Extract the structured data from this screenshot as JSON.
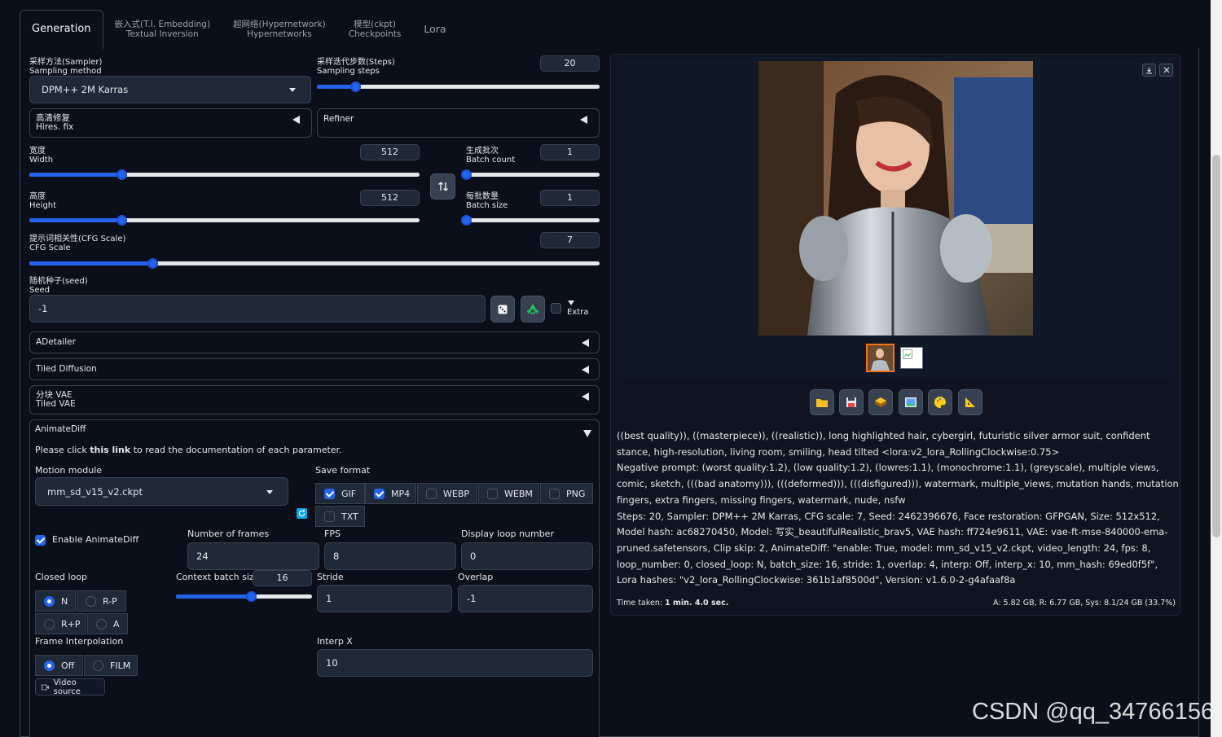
{
  "tabs": [
    {
      "label": "Generation"
    },
    {
      "label": "嵌入式(T.I. Embedding)",
      "sub": "Textual Inversion"
    },
    {
      "label": "超网络(Hypernetwork)",
      "sub": "Hypernetworks"
    },
    {
      "label": "模型(ckpt)",
      "sub": "Checkpoints"
    },
    {
      "label": "Lora"
    }
  ],
  "sampler": {
    "label_cn": "采样方法(Sampler)",
    "label_en": "Sampling method",
    "value": "DPM++ 2M Karras"
  },
  "steps": {
    "label_cn": "采样迭代步数(Steps)",
    "label_en": "Sampling steps",
    "value": "20",
    "fraction": 0.135
  },
  "hires": {
    "label_cn": "高清修复",
    "label_en": "Hires. fix"
  },
  "refiner": {
    "label": "Refiner"
  },
  "width": {
    "label_cn": "宽度",
    "label_en": "Width",
    "value": "512",
    "fraction": 0.235
  },
  "height": {
    "label_cn": "高度",
    "label_en": "Height",
    "value": "512",
    "fraction": 0.235
  },
  "batch_count": {
    "label_cn": "生成批次",
    "label_en": "Batch count",
    "value": "1",
    "fraction": 0.0
  },
  "batch_size": {
    "label_cn": "每批数量",
    "label_en": "Batch size",
    "value": "1",
    "fraction": 0.0
  },
  "swap_icon": "swap-arrows-icon",
  "cfg": {
    "label_cn": "提示词相关性(CFG Scale)",
    "label_en": "CFG Scale",
    "value": "7",
    "fraction": 0.215
  },
  "seed": {
    "label_cn": "随机种子(seed)",
    "label_en": "Seed",
    "value": "-1",
    "extra_label": "Extra"
  },
  "accordions": {
    "adetailer": "ADetailer",
    "tiled_diffusion": "Tiled Diffusion",
    "tiled_vae_cn": "分块 VAE",
    "tiled_vae_en": "Tiled VAE",
    "animatediff": "AnimateDiff"
  },
  "animatediff": {
    "doc_pre": "Please click ",
    "doc_link": "this link",
    "doc_post": " to read the documentation of each parameter.",
    "motion_label": "Motion module",
    "motion_value": "mm_sd_v15_v2.ckpt",
    "save_format_label": "Save format",
    "formats": [
      {
        "label": "GIF",
        "checked": true
      },
      {
        "label": "MP4",
        "checked": true
      },
      {
        "label": "WEBP",
        "checked": false
      },
      {
        "label": "WEBM",
        "checked": false
      },
      {
        "label": "PNG",
        "checked": false
      },
      {
        "label": "TXT",
        "checked": false
      }
    ],
    "enable_label": "Enable AnimateDiff",
    "frames_label": "Number of frames",
    "frames_value": "24",
    "fps_label": "FPS",
    "fps_value": "8",
    "loop_label": "Display loop number",
    "loop_value": "0",
    "closed_loop_label": "Closed loop",
    "closed_loop_options": [
      "N",
      "R-P",
      "R+P",
      "A"
    ],
    "context_label": "Context batch size",
    "context_value": "16",
    "context_fraction": 0.55,
    "stride_label": "Stride",
    "stride_value": "1",
    "overlap_label": "Overlap",
    "overlap_value": "-1",
    "interp_label": "Frame Interpolation",
    "interp_options": [
      "Off",
      "FILM"
    ],
    "interpx_label": "Interp X",
    "interpx_value": "10",
    "video_source_label": "Video source"
  },
  "output": {
    "prompt": "((best quality)), ((masterpiece)), ((realistic)), long highlighted hair, cybergirl, futuristic silver armor suit, confident stance, high-resolution, living room, smiling, head tilted <lora:v2_lora_RollingClockwise:0.75>",
    "negative": "Negative prompt: (worst quality:1.2), (low quality:1.2), (lowres:1.1), (monochrome:1.1), (greyscale), multiple views, comic, sketch, (((bad anatomy))), (((deformed))), (((disfigured))), watermark, multiple_views, mutation hands, mutation fingers, extra fingers, missing fingers, watermark, nude, nsfw",
    "params": "Steps: 20, Sampler: DPM++ 2M Karras, CFG scale: 7, Seed: 2462396676, Face restoration: GFPGAN, Size: 512x512, Model hash: ac68270450, Model: 写实_beautifulRealistic_brav5, VAE hash: ff724e9611, VAE: vae-ft-mse-840000-ema-pruned.safetensors, Clip skip: 2, AnimateDiff: \"enable: True, model: mm_sd_v15_v2.ckpt, video_length: 24, fps: 8, loop_number: 0, closed_loop: N, batch_size: 16, stride: 1, overlap: 4, interp: Off, interp_x: 10, mm_hash: 69ed0f5f\", Lora hashes: \"v2_lora_RollingClockwise: 361b1af8500d\", Version: v1.6.0-2-g4afaaf8a",
    "time_label": "Time taken: ",
    "time_value": "1 min. 4.0 sec.",
    "memory": "A: 5.82 GB, R: 6.77 GB, Sys: 8.1/24 GB (33.7%)"
  },
  "watermark": "CSDN @qq_34766156",
  "colors": {
    "accent": "#2563eb",
    "bg": "#0b0f19",
    "panel": "#1f2937",
    "border": "#374151"
  }
}
